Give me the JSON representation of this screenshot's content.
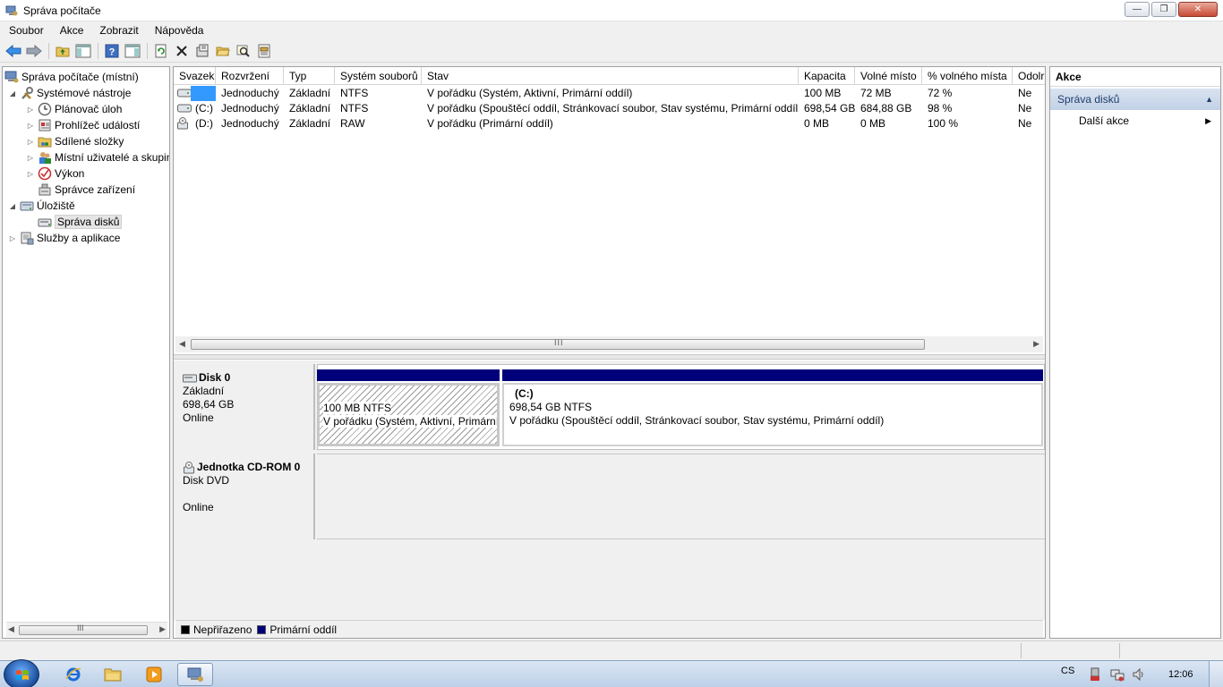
{
  "window": {
    "title": "Správa počítače"
  },
  "menu": [
    "Soubor",
    "Akce",
    "Zobrazit",
    "Nápověda"
  ],
  "toolbar": {
    "icons": [
      "back-arrow-icon",
      "forward-arrow-icon",
      "up-folder-icon",
      "show-hide-tree-icon",
      "help-icon",
      "show-hide-action-icon",
      "refresh-icon",
      "delete-icon",
      "properties-icon",
      "open-folder-icon",
      "search-icon",
      "disk-properties-icon"
    ]
  },
  "tree": {
    "root": "Správa počítače (místní)",
    "system_tools": "Systémové nástroje",
    "task_scheduler": "Plánovač úloh",
    "event_viewer": "Prohlížeč událostí",
    "shared_folders": "Sdílené složky",
    "local_users": "Místní uživatelé a skupiny",
    "performance": "Výkon",
    "device_manager": "Správce zařízení",
    "storage": "Úložiště",
    "disk_management": "Správa disků",
    "services": "Služby a aplikace"
  },
  "volumes": {
    "columns": [
      "Svazek",
      "Rozvržení",
      "Typ",
      "Systém souborů",
      "Stav",
      "Kapacita",
      "Volné místo",
      "% volného místa",
      "Odolr"
    ],
    "rows": [
      {
        "name": "",
        "layout": "Jednoduchý",
        "type": "Základní",
        "fs": "NTFS",
        "status": "V pořádku (Systém, Aktivní, Primární oddíl)",
        "capacity": "100 MB",
        "free": "72 MB",
        "pct": "72 %",
        "fault": "Ne"
      },
      {
        "name": "(C:)",
        "layout": "Jednoduchý",
        "type": "Základní",
        "fs": "NTFS",
        "status": "V pořádku (Spouštěcí oddíl, Stránkovací soubor, Stav systému, Primární oddíl)",
        "capacity": "698,54 GB",
        "free": "684,88 GB",
        "pct": "98 %",
        "fault": "Ne"
      },
      {
        "name": "(D:)",
        "layout": "Jednoduchý",
        "type": "Základní",
        "fs": "RAW",
        "status": "V pořádku (Primární oddíl)",
        "capacity": "0 MB",
        "free": "0 MB",
        "pct": "100 %",
        "fault": "Ne"
      }
    ],
    "scroll_grip": "III"
  },
  "disks": {
    "disk0": {
      "name": "Disk 0",
      "type": "Základní",
      "size": "698,64 GB",
      "state": "Online",
      "part1": {
        "size": "100 MB NTFS",
        "status": "V pořádku (Systém, Aktivní, Primární oddíl)"
      },
      "part2": {
        "label": "(C:)",
        "size": "698,54 GB NTFS",
        "status": "V pořádku (Spouštěcí oddíl, Stránkovací soubor, Stav systému, Primární oddíl)"
      }
    },
    "cdrom": {
      "name": "Jednotka CD-ROM 0",
      "type": "Disk DVD",
      "state": "Online"
    }
  },
  "legend": {
    "unallocated": "Nepřiřazeno",
    "primary": "Primární oddíl",
    "unallocated_color": "#000000",
    "primary_color": "#00007b"
  },
  "actions": {
    "header": "Akce",
    "section": "Správa disků",
    "more": "Další akce"
  },
  "left_scroll_grip": "III",
  "taskbar": {
    "apps": [
      "internet-explorer-icon",
      "explorer-folder-icon",
      "media-player-icon",
      "computer-management-icon"
    ],
    "language": "CS",
    "clock": "12:06"
  }
}
